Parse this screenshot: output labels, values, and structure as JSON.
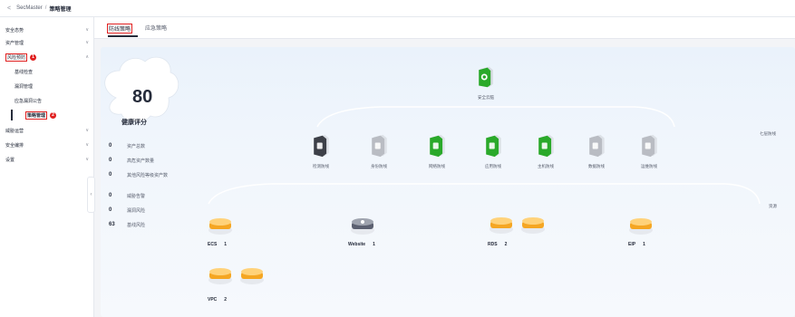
{
  "breadcrumb": {
    "back": "<",
    "parent": "SecMaster",
    "separator": "/",
    "current": "策略管理"
  },
  "sidebar": {
    "items": [
      {
        "label": "安全态势",
        "chevron": "∨"
      },
      {
        "label": "资产管理",
        "chevron": "∨"
      },
      {
        "label": "风险预防",
        "chevron": "∧",
        "badge": "1"
      },
      {
        "label": "威胁运营",
        "chevron": "∨"
      },
      {
        "label": "安全编排",
        "chevron": "∨"
      },
      {
        "label": "设置",
        "chevron": "∨"
      }
    ],
    "subitems": [
      {
        "label": "基线检查"
      },
      {
        "label": "漏洞管理"
      },
      {
        "label": "应急漏洞公告"
      },
      {
        "label": "策略管理",
        "badge": "2"
      }
    ],
    "collapse": "‹"
  },
  "tabs": [
    {
      "label": "防线策略"
    },
    {
      "label": "应急策略"
    }
  ],
  "summary": {
    "score": "80",
    "score_label": "健康评分",
    "stats": [
      {
        "value": "0",
        "label": "资产总数"
      },
      {
        "value": "0",
        "label": "高危资产数量"
      },
      {
        "value": "0",
        "label": "其他风险等级资产数"
      },
      {
        "value": "0",
        "label": "威胁告警"
      },
      {
        "value": "0",
        "label": "漏洞风险"
      },
      {
        "value": "63",
        "label": "基线风险"
      }
    ]
  },
  "top_node": {
    "label": "安全云脑",
    "icon": "brain-icon"
  },
  "defense_layers": [
    {
      "label": "检测防线",
      "color": "#3d4048"
    },
    {
      "label": "身份防线",
      "color": "#b9bcc3"
    },
    {
      "label": "网络防线",
      "color": "#2aa92a"
    },
    {
      "label": "应用防线",
      "color": "#2aa92a"
    },
    {
      "label": "主机防线",
      "color": "#2aa92a"
    },
    {
      "label": "数据防线",
      "color": "#b9bcc3"
    },
    {
      "label": "运维防线",
      "color": "#b9bcc3"
    }
  ],
  "side_labels": {
    "layers": "七层防线",
    "assets": "资源"
  },
  "assets": [
    {
      "name": "ECS",
      "count": "1"
    },
    {
      "name": "Website",
      "count": "1"
    },
    {
      "name": "RDS",
      "count": "2"
    },
    {
      "name": "EIP",
      "count": "1"
    },
    {
      "name": "VPC",
      "count": "2"
    }
  ],
  "colors": {
    "accent_red": "#e02020",
    "green": "#2aa92a",
    "orange": "#f5a623"
  }
}
